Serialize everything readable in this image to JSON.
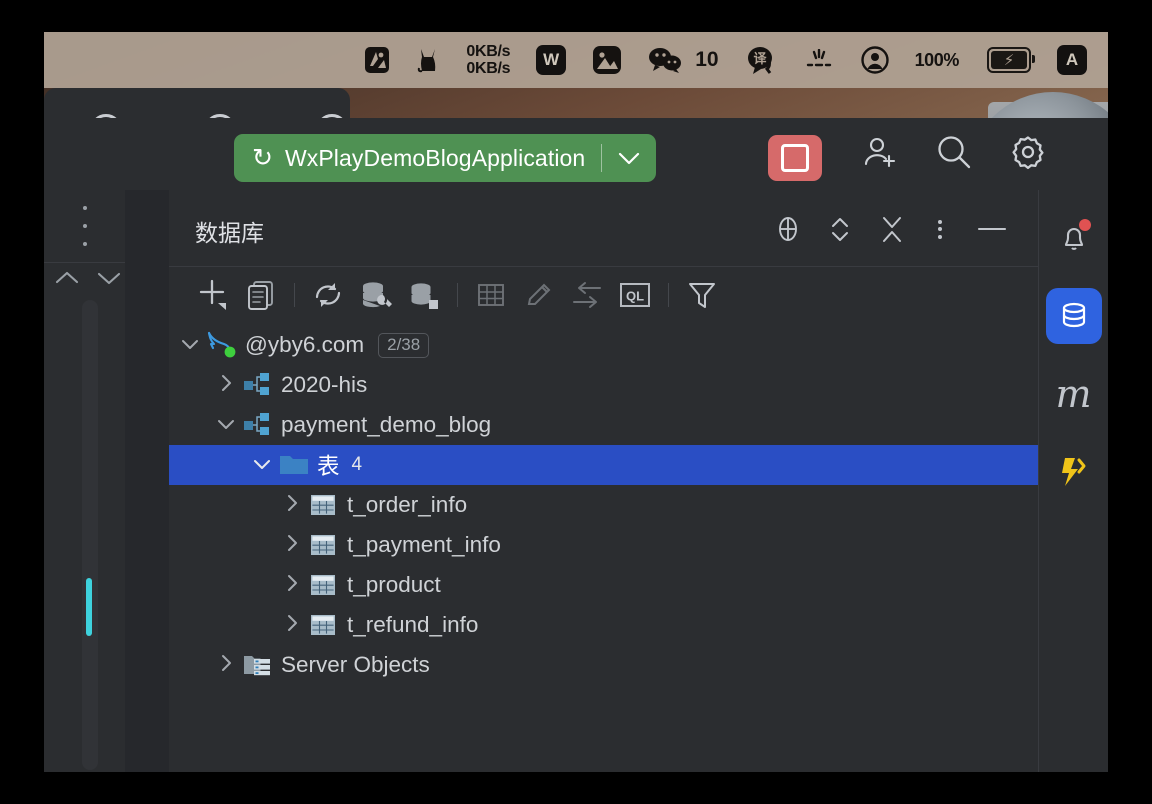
{
  "menubar": {
    "items": [
      {
        "name": "graphics-switch-icon",
        "type": "icon",
        "label": ""
      },
      {
        "name": "cat-icon",
        "type": "icon",
        "label": ""
      },
      {
        "name": "network-speed",
        "type": "text",
        "up": "0KB/s",
        "down": "0KB/s"
      },
      {
        "name": "wps-office-icon",
        "type": "icon",
        "label": "W"
      },
      {
        "name": "photos-icon",
        "type": "icon",
        "label": ""
      },
      {
        "name": "wechat-icon",
        "type": "icon",
        "label": ""
      },
      {
        "name": "wechat-unread-count",
        "type": "text",
        "label": "10"
      },
      {
        "name": "translate-icon",
        "type": "icon",
        "label": "译"
      },
      {
        "name": "brightness-icon",
        "type": "icon",
        "label": ""
      },
      {
        "name": "user-account-icon",
        "type": "icon",
        "label": ""
      },
      {
        "name": "battery-percentage",
        "type": "text",
        "label": "100%"
      },
      {
        "name": "battery-charging-icon",
        "type": "icon",
        "label": ""
      },
      {
        "name": "input-method-indicator",
        "type": "badge",
        "label": "A"
      }
    ],
    "battery_percent": "100%",
    "network_up": "0KB/s",
    "network_down": "0KB/s",
    "wechat_count": "10",
    "input_method": "A",
    "translate_glyph": "译",
    "wps_glyph": "W"
  },
  "toolbar": {
    "run_configuration": "WxPlayDemoBlogApplication",
    "run_icon": "rerun-icon",
    "dropdown_icon": "chevron-down-icon",
    "stop_label": "",
    "stop_icon": "stop-square-icon",
    "right_icons": [
      {
        "name": "add-user-icon",
        "label": ""
      },
      {
        "name": "search-icon",
        "label": ""
      },
      {
        "name": "settings-gear-icon",
        "label": ""
      }
    ],
    "run_button_color": "#4f9153",
    "stop_button_color": "#d66a6a"
  },
  "database_panel": {
    "title": "数据库",
    "header_actions": [
      {
        "name": "locate-in-tree-icon",
        "label": ""
      },
      {
        "name": "expand-collapse-icon",
        "label": ""
      },
      {
        "name": "collapse-all-icon",
        "label": ""
      },
      {
        "name": "more-options-icon",
        "label": ""
      },
      {
        "name": "hide-panel-icon",
        "label": ""
      }
    ],
    "toolbar_actions": [
      {
        "name": "add-data-source-button",
        "label": "+",
        "enabled": true
      },
      {
        "name": "duplicate-button",
        "label": "",
        "enabled": true
      },
      {
        "name": "refresh-button",
        "label": "",
        "enabled": true
      },
      {
        "name": "data-source-properties-button",
        "label": "",
        "enabled": true
      },
      {
        "name": "add-database-button",
        "label": "",
        "enabled": true
      },
      {
        "name": "open-table-editor-button",
        "label": "",
        "enabled": false
      },
      {
        "name": "modify-object-button",
        "label": "",
        "enabled": false
      },
      {
        "name": "jump-to-source-button",
        "label": "",
        "enabled": false
      },
      {
        "name": "open-query-console-button",
        "label": "QL",
        "enabled": true
      },
      {
        "name": "filter-button",
        "label": "",
        "enabled": true
      }
    ],
    "tree": [
      {
        "id": "datasource",
        "label": "@yby6.com",
        "badge": "2/38",
        "icon": "mysql-dolphin-icon",
        "expanded": true,
        "selected": false,
        "indent": 0,
        "status": "connected"
      },
      {
        "id": "schema-2020-his",
        "label": "2020-his",
        "badge": "",
        "icon": "schema-icon",
        "expanded": false,
        "selected": false,
        "indent": 1
      },
      {
        "id": "schema-payment-demo-blog",
        "label": "payment_demo_blog",
        "badge": "",
        "icon": "schema-icon",
        "expanded": true,
        "selected": false,
        "indent": 1
      },
      {
        "id": "tables-group",
        "label": "表",
        "count": "4",
        "icon": "folder-icon",
        "expanded": true,
        "selected": true,
        "indent": 2
      },
      {
        "id": "table-t-order-info",
        "label": "t_order_info",
        "icon": "table-icon",
        "expanded": false,
        "selected": false,
        "indent": 3
      },
      {
        "id": "table-t-payment-info",
        "label": "t_payment_info",
        "icon": "table-icon",
        "expanded": false,
        "selected": false,
        "indent": 3
      },
      {
        "id": "table-t-product",
        "label": "t_product",
        "icon": "table-icon",
        "expanded": false,
        "selected": false,
        "indent": 3
      },
      {
        "id": "table-t-refund-info",
        "label": "t_refund_info",
        "icon": "table-icon",
        "expanded": false,
        "selected": false,
        "indent": 3
      },
      {
        "id": "server-objects",
        "label": "Server Objects",
        "icon": "server-icon",
        "expanded": false,
        "selected": false,
        "indent": 1
      }
    ]
  },
  "right_sidebar": {
    "items": [
      {
        "name": "notifications-button",
        "icon": "bell-icon",
        "label": "",
        "active": false,
        "has_badge": true
      },
      {
        "name": "database-tool-button",
        "icon": "database-icon",
        "label": "",
        "active": true,
        "has_badge": false
      },
      {
        "name": "maven-tool-button",
        "icon": "maven-m-icon",
        "label": "m",
        "active": false,
        "has_badge": false
      },
      {
        "name": "lightning-tool-button",
        "icon": "lightning-icon",
        "label": "",
        "active": false,
        "has_badge": false
      }
    ]
  },
  "colors": {
    "selection_blue": "#2a4ec4",
    "accent_blue": "#2f63e0",
    "panel_bg": "#2b2d30",
    "run_green": "#4f9153",
    "stop_red": "#d66a6a",
    "connected_green": "#3ecf3e",
    "marker_cyan": "#3ed2dd",
    "badge_red": "#e05252"
  }
}
